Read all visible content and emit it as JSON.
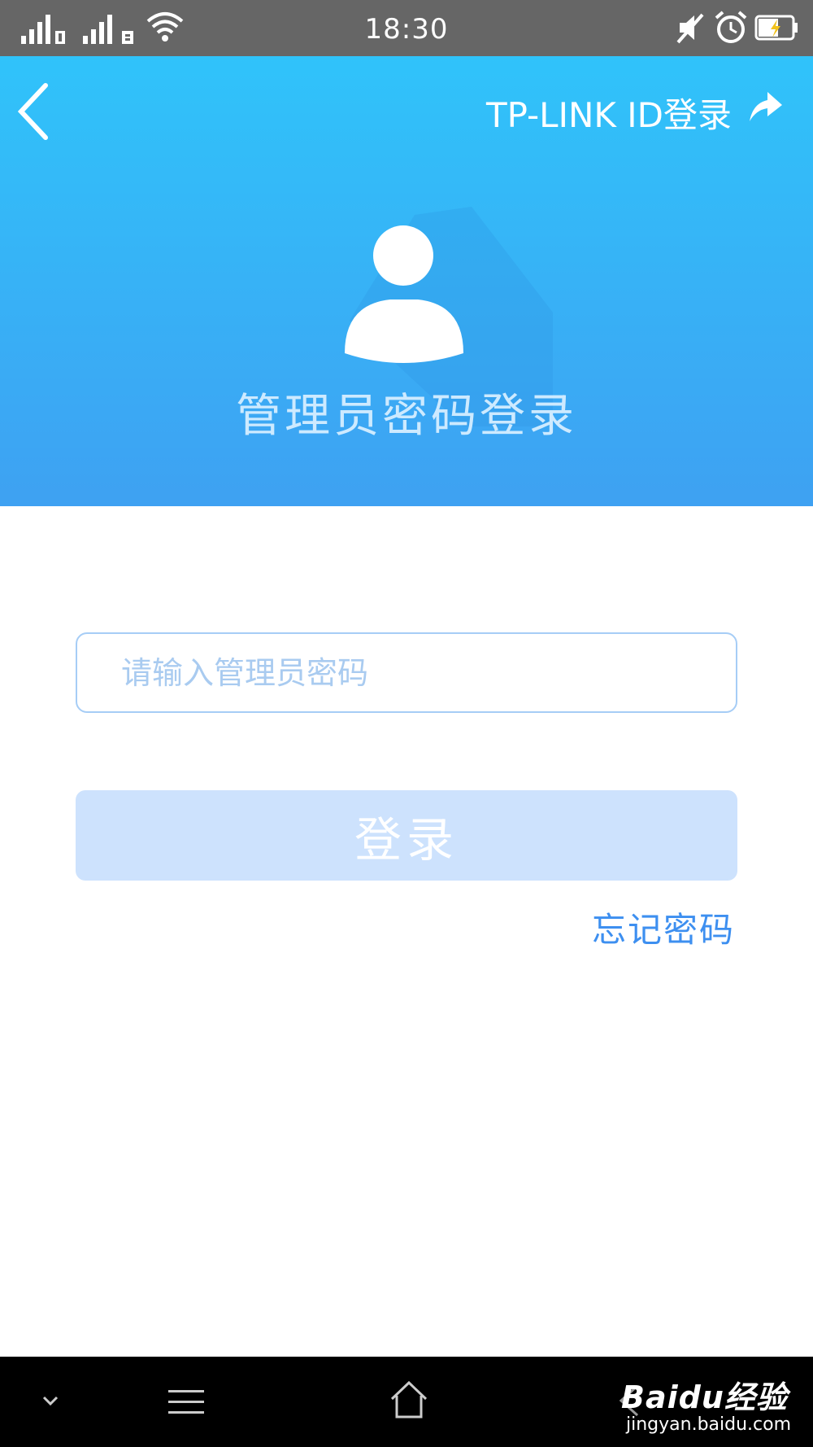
{
  "status_bar": {
    "time": "18:30",
    "icons": [
      "signal-sim1-icon",
      "signal-sim2-icon",
      "wifi-icon",
      "mute-icon",
      "alarm-icon",
      "battery-charging-icon"
    ]
  },
  "header": {
    "tplink_login_label": "TP-LINK ID登录",
    "title": "管理员密码登录",
    "icons": [
      "back-arrow-icon",
      "export-icon",
      "user-avatar-icon"
    ]
  },
  "form": {
    "password_placeholder": "请输入管理员密码",
    "password_value": "",
    "login_label": "登录",
    "forgot_label": "忘记密码"
  },
  "nav_bar": {
    "icons": [
      "collapse-chevron-icon",
      "menu-icon",
      "home-icon",
      "back-icon"
    ]
  },
  "watermark": {
    "brand": "Baidu经验",
    "url": "jingyan.baidu.com"
  },
  "colors": {
    "header_top": "#30c3fa",
    "header_bottom": "#3ea1f2",
    "input_border": "#a6cdf6",
    "button_disabled": "#cde2fd",
    "link": "#3d8ff0",
    "status_bar": "#666666",
    "nav_bar": "#000000"
  }
}
